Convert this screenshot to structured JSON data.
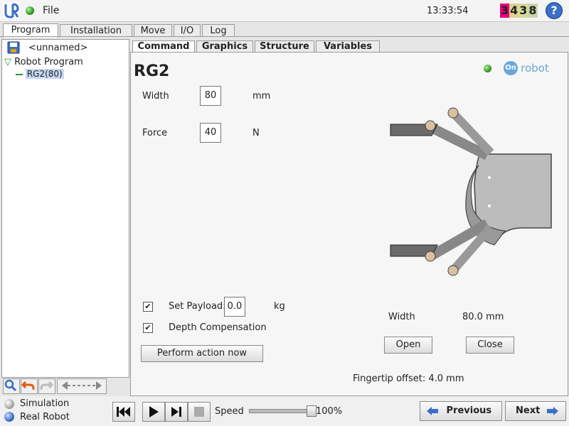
{
  "topbar": {
    "file_label": "File",
    "clock": "13:33:54",
    "counter_digits": [
      "3",
      "4",
      "3",
      "8"
    ],
    "counter_colors": [
      "#e6007e",
      "#d8c25a",
      "#c5e35a",
      "#a0c0e0"
    ],
    "help_label": "?"
  },
  "main_tabs": [
    {
      "label": "Program"
    },
    {
      "label": "Installation"
    },
    {
      "label": "Move"
    },
    {
      "label": "I/O"
    },
    {
      "label": "Log"
    }
  ],
  "program_tree": {
    "file_name": "<unnamed>",
    "root_label": "Robot Program",
    "child_label": "RG2(80)"
  },
  "sub_tabs": [
    {
      "label": "Command"
    },
    {
      "label": "Graphics"
    },
    {
      "label": "Structure"
    },
    {
      "label": "Variables"
    }
  ],
  "command": {
    "title": "RG2",
    "brand": "robot",
    "brand_prefix": "On",
    "width_label": "Width",
    "width_value": "80",
    "width_unit": "mm",
    "force_label": "Force",
    "force_value": "40",
    "force_unit": "N",
    "payload_label": "Set Payload:",
    "payload_value": "0.0",
    "payload_unit": "kg",
    "payload_checked": "✔",
    "depth_label": "Depth Compensation",
    "depth_checked": "✔",
    "perform_label": "Perform action now",
    "status_width_label": "Width",
    "status_width_value": "80.0 mm",
    "open_label": "Open",
    "close_label": "Close",
    "fingertip_text": "Fingertip offset: 4.0 mm"
  },
  "bottom": {
    "simulation_label": "Simulation",
    "real_robot_label": "Real Robot",
    "speed_label": "Speed",
    "speed_value": "100%",
    "speed_fraction": 1.0,
    "previous_label": "Previous",
    "next_label": "Next"
  }
}
